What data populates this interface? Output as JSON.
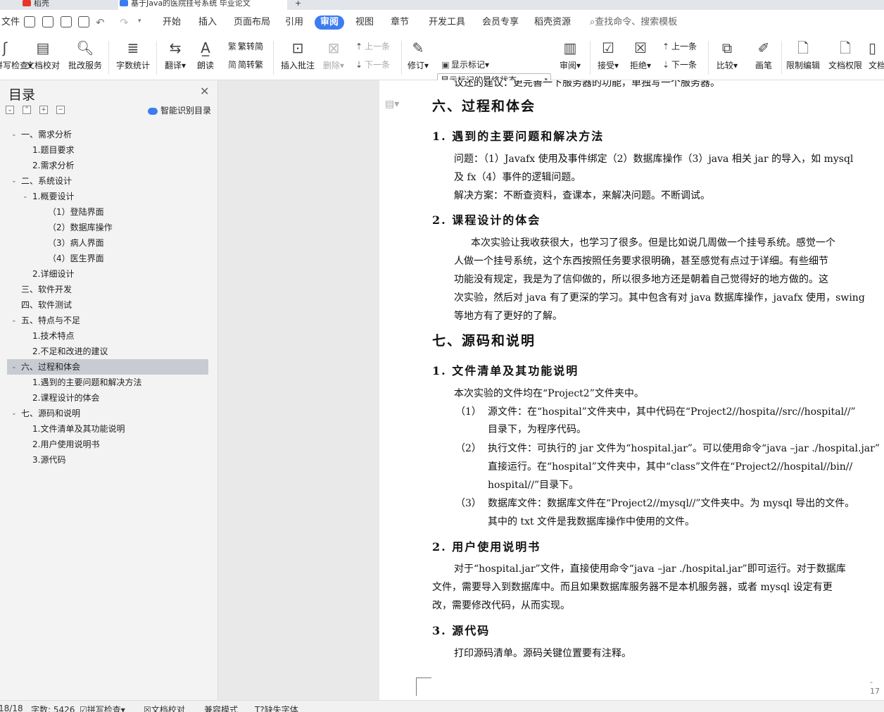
{
  "tabs": [
    {
      "label": "稻壳",
      "color": "#e8352b"
    },
    {
      "label": "基于Java的医院挂号系统 毕业论文",
      "color": "#3b7df1"
    }
  ],
  "menu": {
    "file": "文件",
    "items": [
      "开始",
      "插入",
      "页面布局",
      "引用",
      "审阅",
      "视图",
      "章节",
      "开发工具",
      "会员专享",
      "稻壳资源"
    ],
    "active": "审阅",
    "search": "查找命令、搜索模板"
  },
  "toolbar": {
    "spellcheck": "拼写检查",
    "doc_proof": "文档校对",
    "batch_service": "批改服务",
    "word_count": "字数统计",
    "translate": "翻译",
    "read_aloud": "朗读",
    "trad_to_simp": "繁转简",
    "simp_to_trad": "简转繁",
    "insert_comment": "插入批注",
    "delete": "删除",
    "prev_comment": "上一条",
    "next_comment": "下一条",
    "track": "修订",
    "display_state": "显示标记的最终状态",
    "show_markup": "显示标记",
    "review": "审阅",
    "accept": "接受",
    "reject": "拒绝",
    "prev_change": "上一条",
    "next_change": "下一条",
    "compare": "比较",
    "pen": "画笔",
    "restrict_edit": "限制编辑",
    "doc_permission": "文档权限",
    "doc_more": "文档"
  },
  "sidebar": {
    "title": "目录",
    "smart": "智能识别目录",
    "items": [
      {
        "label": "一、需求分析",
        "level": 1,
        "caret": true
      },
      {
        "label": "1.题目要求",
        "level": 2
      },
      {
        "label": "2.需求分析",
        "level": 2
      },
      {
        "label": "二、系统设计",
        "level": 1,
        "caret": true
      },
      {
        "label": "1.概要设计",
        "level": 2,
        "caret": true
      },
      {
        "label": "（1）登陆界面",
        "level": 3
      },
      {
        "label": "（2）数据库操作",
        "level": 3
      },
      {
        "label": "（3）病人界面",
        "level": 3
      },
      {
        "label": "（4）医生界面",
        "level": 3
      },
      {
        "label": "2.详细设计",
        "level": 2
      },
      {
        "label": "三、软件开发",
        "level": 1
      },
      {
        "label": "四、软件测试",
        "level": 1
      },
      {
        "label": "五、特点与不足",
        "level": 1,
        "caret": true
      },
      {
        "label": "1.技术特点",
        "level": 2
      },
      {
        "label": "2.不足和改进的建议",
        "level": 2
      },
      {
        "label": "六、过程和体会",
        "level": 1,
        "caret": true,
        "active": true
      },
      {
        "label": "1.遇到的主要问题和解决方法",
        "level": 2
      },
      {
        "label": "2.课程设计的体会",
        "level": 2
      },
      {
        "label": "七、源码和说明",
        "level": 1,
        "caret": true
      },
      {
        "label": "1.文件清单及其功能说明",
        "level": 2
      },
      {
        "label": "2.用户使用说明书",
        "level": 2
      },
      {
        "label": "3.源代码",
        "level": 2
      }
    ]
  },
  "doc": {
    "top_fragment": "议还的建议：更完善一下服务器的功能，单独写一个服务器。",
    "h_six": "六、过程和体会",
    "h_six_1": "1. 遇到的主要问题和解决方法",
    "p1a": "问题：（1）Javafx 使用及事件绑定（2）数据库操作（3）java 相关 jar 的导入，如 mysql",
    "p1b": "及 fx（4）事件的逻辑问题。",
    "p1c": "解决方案：不断查资料，查课本，来解决问题。不断调试。",
    "h_six_2": "2. 课程设计的体会",
    "p2a": "本次实验让我收获很大，也学习了很多。但是比如说几周做一个挂号系统。感觉一个",
    "p2b": "人做一个挂号系统，这个东西按照任务要求很明确，甚至感觉有点过于详细。有些细节",
    "p2c": "功能没有规定，我是为了信仰做的，所以很多地方还是朝着自己觉得好的地方做的。这",
    "p2d": "次实验，然后对 java 有了更深的学习。其中包含有对 java 数据库操作，javafx 使用，swing",
    "p2e": "等地方有了更好的了解。",
    "h_seven": "七、源码和说明",
    "h_seven_1": "1. 文件清单及其功能说明",
    "p3": "本次实验的文件均在“Project2”文件夹中。",
    "li1_num": "（1）",
    "li1a": "源文件：在“hospital”文件夹中，其中代码在“Project2//hospita//src//hospital//”",
    "li1b": "目录下，为程序代码。",
    "li2_num": "（2）",
    "li2a": "执行文件：可执行的 jar 文件为“hospital.jar”。可以使用命令“java –jar ./hospital.jar”",
    "li2b": "直接运行。在“hospital”文件夹中，其中“class”文件在“Project2//hospital//bin//",
    "li2c": "hospital//”目录下。",
    "li3_num": "（3）",
    "li3a": "数据库文件：数据库文件在“Project2//mysql//”文件夹中。为 mysql 导出的文件。",
    "li3b": "其中的 txt 文件是我数据库操作中使用的文件。",
    "h_seven_2": "2. 用户使用说明书",
    "p4a": "对于“hospital.jar”文件，直接使用命令“java –jar ./hospital.jar”即可运行。对于数据库",
    "p4b": "文件，需要导入到数据库中。而且如果数据库服务器不是本机服务器，或者 mysql 设定有更",
    "p4c": "改，需要修改代码，从而实现。",
    "h_seven_3": "3. 源代码",
    "p5": "打印源码清单。源码关键位置要有注释。",
    "page_number": "- 17"
  },
  "status": {
    "page": "18/18",
    "word_count": "字数: 5426",
    "spell": "拼写检查",
    "proof": "文档校对",
    "compat": "兼容模式",
    "missing_font": "缺失字体"
  }
}
